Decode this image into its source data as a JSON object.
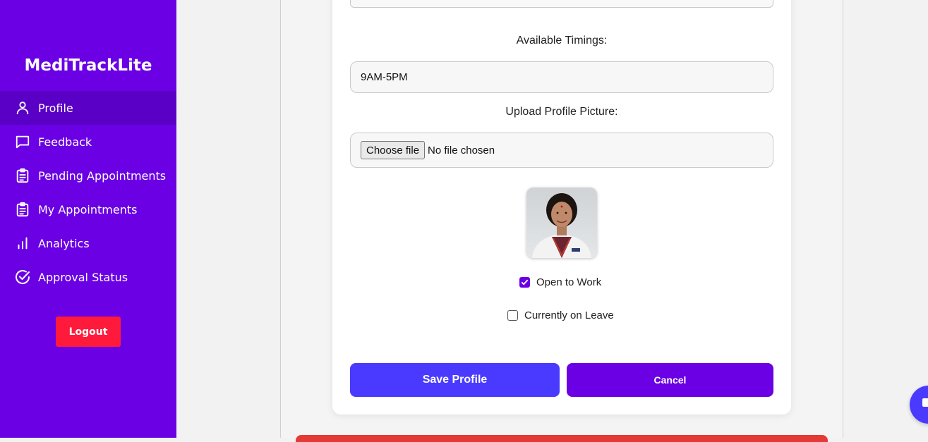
{
  "sidebar": {
    "brand": "MediTrackLite",
    "items": [
      {
        "label": "Profile",
        "icon": "user-icon",
        "active": true
      },
      {
        "label": "Feedback",
        "icon": "message-square-icon"
      },
      {
        "label": "Pending Appointments",
        "icon": "clipboard-icon"
      },
      {
        "label": "My Appointments",
        "icon": "clipboard-icon"
      },
      {
        "label": "Analytics",
        "icon": "bar-chart-icon"
      },
      {
        "label": "Approval Status",
        "icon": "check-circle-icon"
      }
    ],
    "logout_label": "Logout"
  },
  "form": {
    "timings_label": "Available Timings:",
    "timings_value": "9AM-5PM",
    "upload_label": "Upload Profile Picture:",
    "choose_file_label": "Choose file",
    "file_status": "No file chosen",
    "open_to_work_label": "Open to Work",
    "open_to_work_checked": true,
    "on_leave_label": "Currently on Leave",
    "on_leave_checked": false,
    "save_label": "Save Profile",
    "cancel_label": "Cancel"
  },
  "colors": {
    "sidebar_bg": "#6a00e3",
    "active_item_bg": "#5a00c6",
    "logout_bg": "#ff1a3c",
    "save_bg": "#4a3aff",
    "cancel_bg": "#6a00e3"
  }
}
